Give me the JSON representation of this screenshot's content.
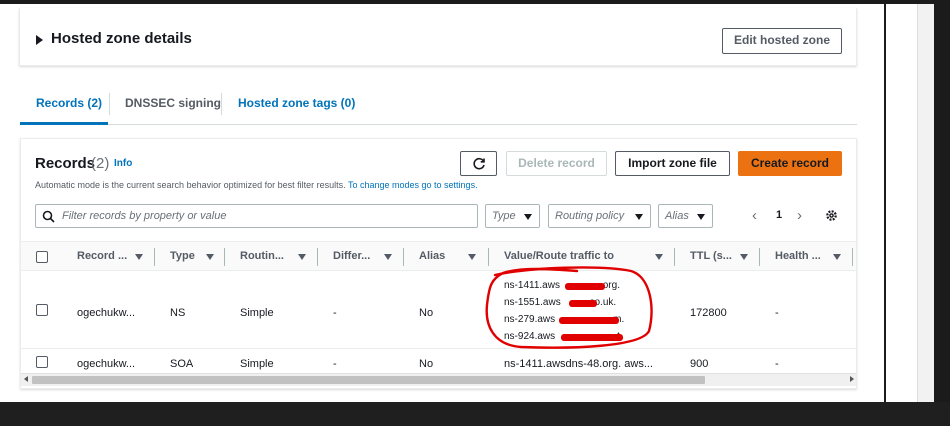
{
  "hosted_zone": {
    "title": "Hosted zone details",
    "edit_button": "Edit hosted zone"
  },
  "tabs": [
    {
      "label": "Records (2)"
    },
    {
      "label": "DNSSEC signing"
    },
    {
      "label": "Hosted zone tags (0)"
    }
  ],
  "records": {
    "title": "Records",
    "count": "(2)",
    "info": "Info",
    "description": "Automatic mode is the current search behavior optimized for best filter results.",
    "description_link": "To change modes go to settings.",
    "delete_button": "Delete record",
    "import_button": "Import zone file",
    "create_button": "Create record",
    "search_placeholder": "Filter records by property or value",
    "filters": {
      "type": "Type",
      "routing": "Routing policy",
      "alias": "Alias"
    },
    "page": "1",
    "columns": [
      "Record ...",
      "Type",
      "Routin...",
      "Differ...",
      "Alias",
      "Value/Route traffic to",
      "TTL (s...",
      "Health ..."
    ],
    "rows": [
      {
        "record": "ogechukw...",
        "type": "NS",
        "routing": "Simple",
        "differ": "-",
        "alias": "No",
        "values": [
          "ns-1411.aws",
          "ns-1551.aws",
          "ns-279.aws",
          "ns-924.aws"
        ],
        "value_tails": [
          ".org.",
          ".co.uk.",
          "m.",
          "t."
        ],
        "ttl": "172800",
        "health": "-"
      },
      {
        "record": "ogechukw...",
        "type": "SOA",
        "routing": "Simple",
        "differ": "-",
        "alias": "No",
        "value": "ns-1411.awsdns-48.org. aws...",
        "ttl": "900",
        "health": "-"
      }
    ]
  },
  "colors": {
    "accent": "#0073bb",
    "primary_button": "#ec7211",
    "annotation": "#e10000"
  }
}
